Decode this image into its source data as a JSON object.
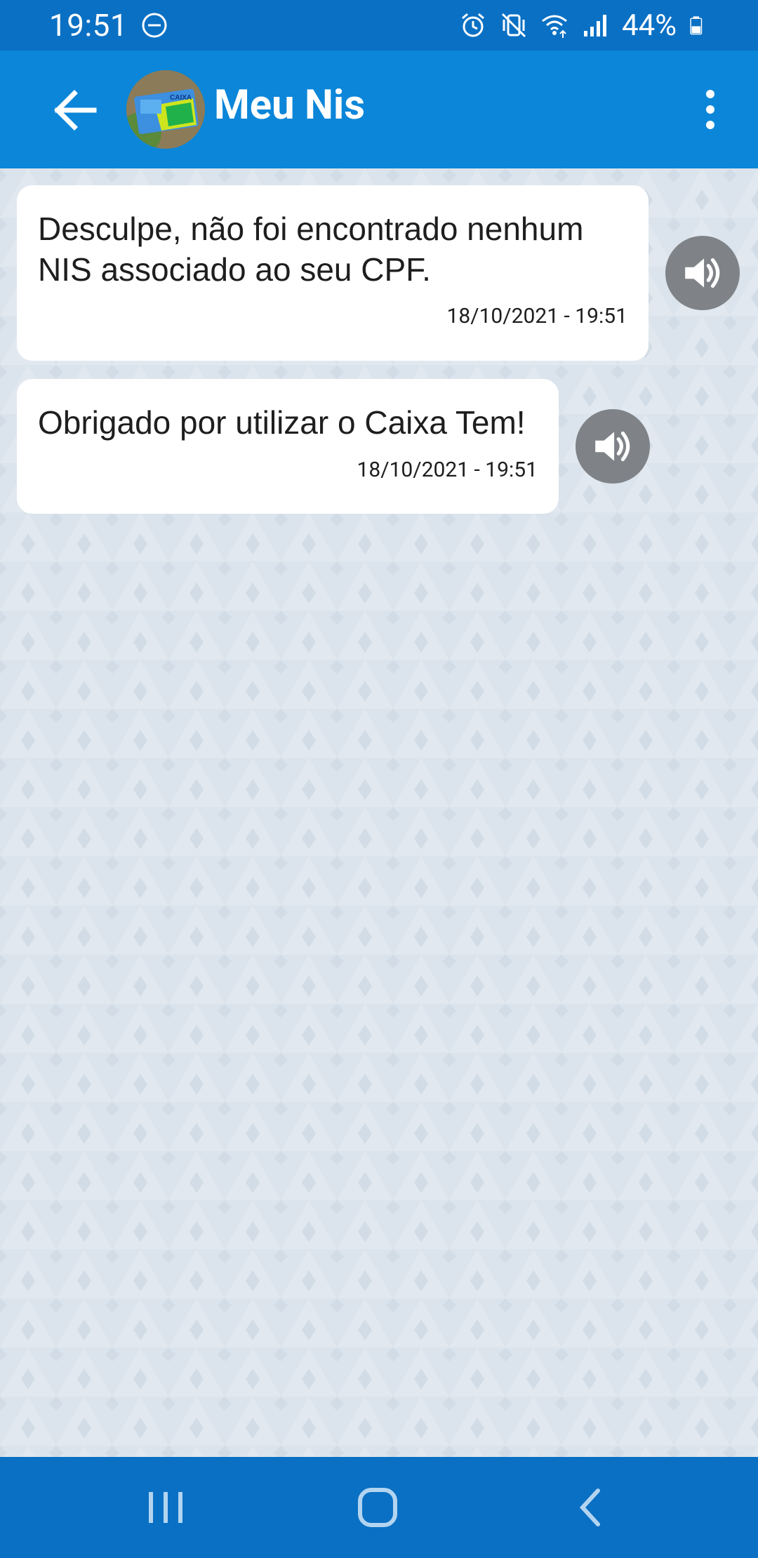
{
  "status_bar": {
    "time": "19:51",
    "battery_percent": "44%",
    "icons": [
      "do-not-disturb-icon",
      "alarm-icon",
      "vibrate-icon",
      "wifi-icon",
      "signal-icon",
      "battery-icon"
    ]
  },
  "app_bar": {
    "title": "Meu Nis",
    "avatar_text": "CAIXA"
  },
  "messages": [
    {
      "text_line1": "Desculpe, não foi encontrado nenhum",
      "text_line2": "NIS associado ao seu CPF.",
      "timestamp": "18/10/2021 - 19:51"
    },
    {
      "text_line1": "Obrigado por utilizar o Caixa Tem!",
      "timestamp": "18/10/2021 - 19:51"
    }
  ],
  "colors": {
    "status_bar": "#0a70c4",
    "app_bar": "#0b86d9",
    "chat_background": "#dbe4ec",
    "bubble": "#ffffff",
    "speaker_button": "#7f8387",
    "nav_bar": "#0a70c4"
  }
}
